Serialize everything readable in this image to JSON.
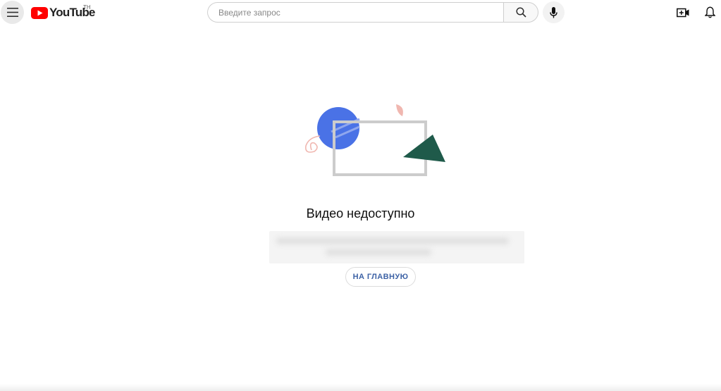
{
  "header": {
    "logo_text": "YouTube",
    "region_code": "TH",
    "search_placeholder": "Введите запрос",
    "icons": {
      "menu": "hamburger-menu-icon",
      "search": "search-icon",
      "mic": "microphone-icon",
      "create": "create-video-icon",
      "notifications": "bell-icon"
    }
  },
  "main": {
    "title": "Видео недоступно",
    "home_button_label": "НА ГЛАВНУЮ"
  },
  "colors": {
    "brand_red": "#ff0000",
    "home_button_text": "#3e63a6",
    "illustration_blue": "#4a72e6",
    "illustration_green": "#1f5a4a",
    "illustration_pink": "#f0b7b0",
    "illustration_frame": "#cccccc"
  }
}
